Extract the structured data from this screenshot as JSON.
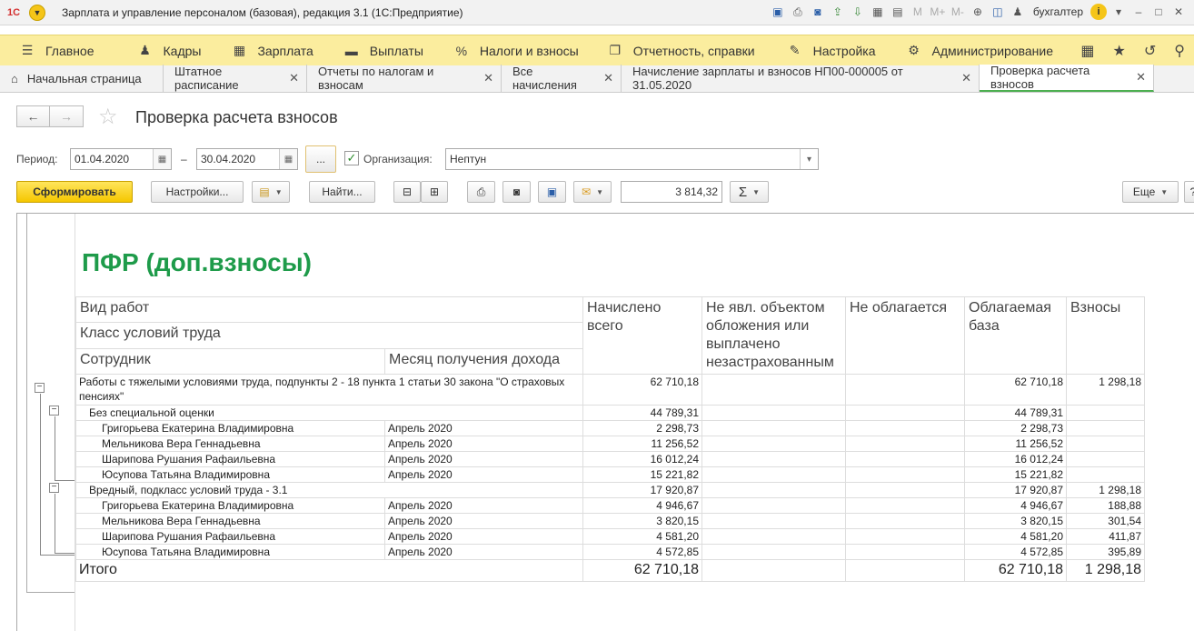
{
  "app": {
    "logo": "1C",
    "title": "Зарплата и управление персоналом (базовая), редакция 3.1  (1С:Предприятие)",
    "user": "бухгалтер",
    "toolbar_labels": {
      "m": "M",
      "mplus": "M+",
      "mminus": "M-"
    }
  },
  "main_menu": [
    {
      "icon": "hamburger-icon",
      "label": "Главное"
    },
    {
      "icon": "people-icon",
      "label": "Кадры"
    },
    {
      "icon": "calculator-icon",
      "label": "Зарплата"
    },
    {
      "icon": "wallet-icon",
      "label": "Выплаты"
    },
    {
      "icon": "percent-icon",
      "label": "Налоги и взносы"
    },
    {
      "icon": "report-icon",
      "label": "Отчетность, справки"
    },
    {
      "icon": "wrench-icon",
      "label": "Настройка"
    },
    {
      "icon": "gear-icon",
      "label": "Администрирование"
    }
  ],
  "tabs": [
    {
      "label": "Начальная страница",
      "closable": false
    },
    {
      "label": "Штатное расписание",
      "closable": true
    },
    {
      "label": "Отчеты по налогам и взносам",
      "closable": true
    },
    {
      "label": "Все начисления",
      "closable": true
    },
    {
      "label": "Начисление зарплаты и взносов НП00-000005 от 31.05.2020",
      "closable": true
    },
    {
      "label": "Проверка расчета взносов",
      "closable": true,
      "active": true
    }
  ],
  "form": {
    "title": "Проверка расчета взносов",
    "period_label": "Период:",
    "date_from": "01.04.2020",
    "dash": "–",
    "date_to": "30.04.2020",
    "ellipsis": "...",
    "org_label": "Организация:",
    "org_value": "Нептун",
    "org_checked": true,
    "btn_generate": "Сформировать",
    "btn_settings": "Настройки...",
    "btn_find": "Найти...",
    "sum_value": "3 814,32",
    "sigma": "Σ",
    "btn_more": "Еще"
  },
  "report": {
    "title": "ПФР (доп.взносы)",
    "headers": {
      "work_type": "Вид работ",
      "class": "Класс условий труда",
      "employee": "Сотрудник",
      "month": "Месяц получения дохода",
      "accrued": "Начислено всего",
      "not_object": "Не явл. объектом обложения или выплачено незастрахованным",
      "not_taxed": "Не облагается",
      "taxable_base": "Облагаемая база",
      "contributions": "Взносы"
    },
    "group": {
      "label": "Работы с тяжелыми условиями труда, подпункты 2 - 18 пункта 1 статьи 30 закона \"О страховых пенсиях\"",
      "accrued": "62 710,18",
      "base": "62 710,18",
      "contrib": "1 298,18"
    },
    "subgroups": [
      {
        "label": "Без специальной оценки",
        "accrued": "44 789,31",
        "base": "44 789,31",
        "contrib": "",
        "rows": [
          {
            "name": "Григорьева Екатерина Владимировна",
            "month": "Апрель 2020",
            "accrued": "2 298,73",
            "base": "2 298,73",
            "contrib": ""
          },
          {
            "name": "Мельникова Вера Геннадьевна",
            "month": "Апрель 2020",
            "accrued": "11 256,52",
            "base": "11 256,52",
            "contrib": ""
          },
          {
            "name": "Шарипова Рушания Рафаильевна",
            "month": "Апрель 2020",
            "accrued": "16 012,24",
            "base": "16 012,24",
            "contrib": ""
          },
          {
            "name": "Юсупова Татьяна Владимировна",
            "month": "Апрель 2020",
            "accrued": "15 221,82",
            "base": "15 221,82",
            "contrib": ""
          }
        ]
      },
      {
        "label": "Вредный, подкласс условий труда - 3.1",
        "accrued": "17 920,87",
        "base": "17 920,87",
        "contrib": "1 298,18",
        "rows": [
          {
            "name": "Григорьева Екатерина Владимировна",
            "month": "Апрель 2020",
            "accrued": "4 946,67",
            "base": "4 946,67",
            "contrib": "188,88"
          },
          {
            "name": "Мельникова Вера Геннадьевна",
            "month": "Апрель 2020",
            "accrued": "3 820,15",
            "base": "3 820,15",
            "contrib": "301,54"
          },
          {
            "name": "Шарипова Рушания Рафаильевна",
            "month": "Апрель 2020",
            "accrued": "4 581,20",
            "base": "4 581,20",
            "contrib": "411,87"
          },
          {
            "name": "Юсупова Татьяна Владимировна",
            "month": "Апрель 2020",
            "accrued": "4 572,85",
            "base": "4 572,85",
            "contrib": "395,89"
          }
        ]
      }
    ],
    "total": {
      "label": "Итого",
      "accrued": "62 710,18",
      "base": "62 710,18",
      "contrib": "1 298,18"
    }
  }
}
